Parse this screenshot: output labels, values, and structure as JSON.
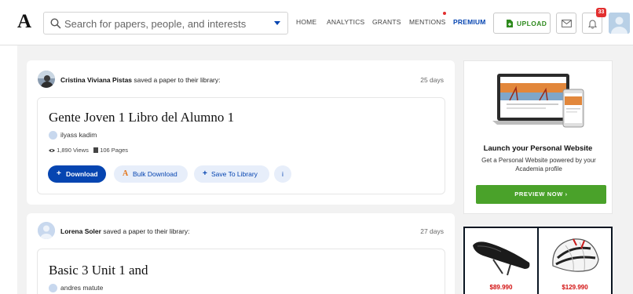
{
  "header": {
    "logo": "A",
    "search_placeholder": "Search for papers, people, and interests",
    "nav": [
      "HOME",
      "ANALYTICS",
      "GRANTS",
      "MENTIONS",
      "PREMIUM"
    ],
    "upload_label": "UPLOAD",
    "notification_count": "33"
  },
  "feed": [
    {
      "actor": "Cristina Viviana Pistas",
      "action": "saved a paper to their library:",
      "time": "25 days",
      "title": "Gente Joven 1 Libro del Alumno 1",
      "author": "ilyass kadim",
      "views": "1,890 Views",
      "pages": "106 Pages",
      "buttons": {
        "download": "Download",
        "bulk_download": "Bulk Download",
        "save": "Save To Library",
        "info": "i"
      }
    },
    {
      "actor": "Lorena Soler",
      "action": "saved a paper to their library:",
      "time": "27 days",
      "title": "Basic 3 Unit 1 and",
      "author": "andres matute"
    }
  ],
  "sidebar": {
    "ad": {
      "title": "Launch your Personal Website",
      "description": "Get a Personal Website powered by your Academia profile",
      "button": "PREVIEW NOW",
      "button_arrow": "›"
    },
    "shop": {
      "prices": [
        "$89.990",
        "$129.990"
      ]
    }
  },
  "colors": {
    "brand_blue": "#0645b1",
    "upload_green": "#2e8a1d",
    "preview_green": "#4aa22a",
    "alert_red": "#e22f2f",
    "price_red": "#d20f0f"
  },
  "icons": {
    "search": "search-icon",
    "dropdown": "chevron-down-icon",
    "upload": "document-plus-icon",
    "messages": "mail-icon",
    "notifications": "bell-icon",
    "views": "eye-icon",
    "pages": "pages-icon",
    "download": "plus-icon",
    "bulk": "academia-a-icon",
    "save": "plus-icon"
  }
}
